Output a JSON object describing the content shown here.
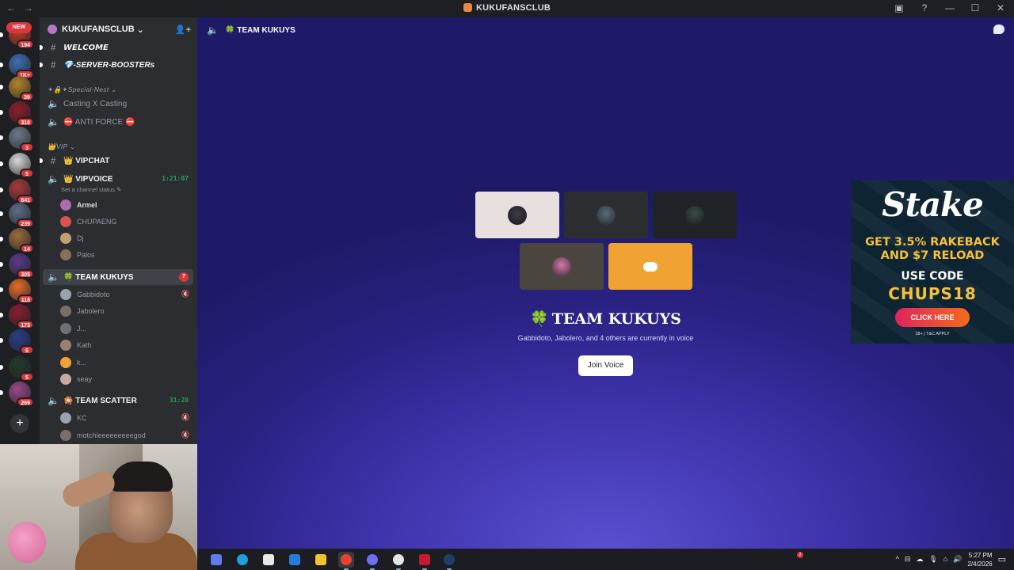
{
  "window": {
    "title": "KUKUFANSCLUB",
    "nav_back": "←",
    "nav_forward": "→",
    "controls": {
      "inbox": "▣",
      "help": "?",
      "minimize": "—",
      "maximize": "☐",
      "close": "✕"
    }
  },
  "rail": {
    "new_label": "NEW",
    "add_label": "+",
    "servers": [
      {
        "badge": "194",
        "color": "#c0392b"
      },
      {
        "badge": "1K+",
        "color": "#3c6fb4"
      },
      {
        "badge": "39",
        "color": "#b5842d"
      },
      {
        "badge": "310",
        "color": "#8b1e2a"
      },
      {
        "badge": "3",
        "color": "#6e7a8a"
      },
      {
        "badge": "5",
        "color": "#d9d9d9"
      },
      {
        "badge": "641",
        "color": "#a63a3a"
      },
      {
        "badge": "239",
        "color": "#5c6d88"
      },
      {
        "badge": "14",
        "color": "#9a6b3e"
      },
      {
        "badge": "305",
        "color": "#5a3a8a"
      },
      {
        "badge": "118",
        "color": "#e86b2a"
      },
      {
        "badge": "173",
        "color": "#8a1e2e"
      },
      {
        "badge": "6",
        "color": "#2a3c8a"
      },
      {
        "badge": "5",
        "color": "#1f3b2a"
      },
      {
        "badge": "269",
        "color": "#9a4a8a"
      }
    ]
  },
  "server": {
    "name": "KUKUFANSCLUB",
    "chevron": "⌄",
    "invite_icon": "👤+",
    "channels": {
      "welcome": "𝙒𝙀𝙇𝘾𝙊𝙈𝙀",
      "boosters": "💎-SERVER-BOOSTERs",
      "cat_special": "✦🔒✦Special-Nest ⌄",
      "casting": "Casting X Casting",
      "anti_force": "⛔ ANTI FORCE ⛔",
      "cat_vip": "👑VIP ⌄",
      "vipchat": "👑 VIPCHAT",
      "vipvoice": "👑 VIPVOICE",
      "vipvoice_timer": "1:21:07",
      "vipvoice_status": "Set a channel status ✎",
      "team_kukuys": "🍀 TEAM KUKUYS",
      "team_kukuys_mentions": "7",
      "team_scatter": "🎇 TEAM SCATTER",
      "team_scatter_timer": "31:28"
    },
    "vip_users": [
      "Armel",
      "CHUPAENG",
      "Dj",
      "Palos"
    ],
    "kukuys_users": [
      "Gabbidoto",
      "Jabolero",
      "J...",
      "Kath",
      "k...",
      "seay"
    ],
    "scatter_users": [
      "KC",
      "motchieeeeeeeeegod"
    ]
  },
  "stage": {
    "channel": "TEAM KUKUYS",
    "clover": "🍀",
    "title": "TEAM KUKUYS",
    "subtitle": "Gabbidoto, Jabolero, and 4 others are currently in voice",
    "join_label": "Join Voice",
    "tiles": [
      {
        "bg": "#e8e0de",
        "avatar": "#3c3b45"
      },
      {
        "bg": "#2b2d31",
        "avatar": "#5a6b78"
      },
      {
        "bg": "#1f2226",
        "avatar": "#3b4a4a"
      },
      {
        "bg": "#4b4540",
        "avatar": "#d27aa8"
      },
      {
        "bg": "#f0a232",
        "avatar": "#ffffff"
      }
    ]
  },
  "ad": {
    "brand": "Stake",
    "line1": "GET 3.5% RAKEBACK",
    "line2": "AND $7 RELOAD",
    "line3": "USE CODE",
    "code": "CHUPS18",
    "cta": "CLICK HERE",
    "fine": "18+ | T&C APPLY"
  },
  "taskbar": {
    "time": "5:27 PM",
    "date": "2/4/2026",
    "notif_count": "2",
    "apps": [
      {
        "name": "copilot",
        "color": "#5e7cf0"
      },
      {
        "name": "edge",
        "color": "#1fa0d8"
      },
      {
        "name": "store",
        "color": "#e8e8e8"
      },
      {
        "name": "mail",
        "color": "#2a7bd6"
      },
      {
        "name": "explorer",
        "color": "#f2c231"
      },
      {
        "name": "chrome",
        "color": "#e54235"
      },
      {
        "name": "discord",
        "color": "#6b6ff2"
      },
      {
        "name": "obs",
        "color": "#e5e5e5"
      },
      {
        "name": "app-red",
        "color": "#c7182e"
      },
      {
        "name": "steam",
        "color": "#1d3f6a"
      }
    ],
    "tray_icons": [
      "^",
      "⊟",
      "☁",
      "🎙",
      "⌂",
      "🔊"
    ]
  }
}
